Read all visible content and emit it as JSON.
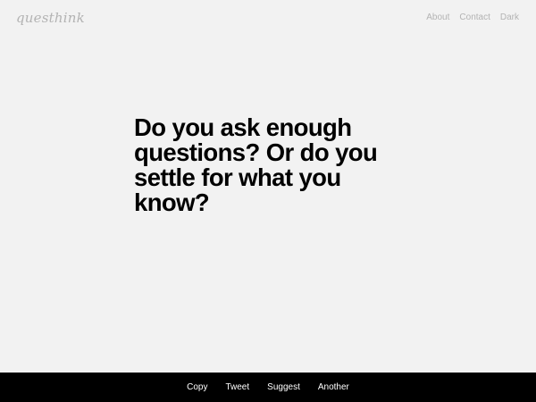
{
  "header": {
    "logo": "questhink",
    "nav": {
      "about": "About",
      "contact": "Contact",
      "dark": "Dark"
    }
  },
  "main": {
    "question": "Do you ask enough questions? Or do you settle for what you know?"
  },
  "footer": {
    "copy": "Copy",
    "tweet": "Tweet",
    "suggest": "Suggest",
    "another": "Another"
  },
  "colors": {
    "background": "#f2f2f2",
    "muted_text": "#b3b3b3",
    "question_text": "#000000",
    "footer_background": "#000000",
    "footer_text": "#ffffff"
  }
}
